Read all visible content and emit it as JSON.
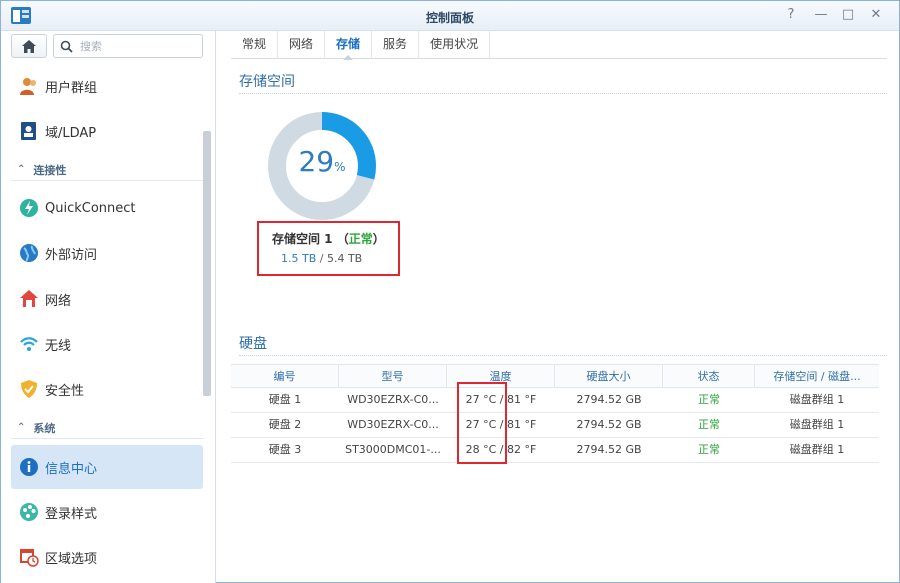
{
  "window": {
    "title": "控制面板"
  },
  "search": {
    "placeholder": "搜索"
  },
  "sidebar": {
    "items": [
      {
        "label": "用户群组"
      },
      {
        "label": "域/LDAP"
      },
      {
        "label": "QuickConnect"
      },
      {
        "label": "外部访问"
      },
      {
        "label": "网络"
      },
      {
        "label": "无线"
      },
      {
        "label": "安全性"
      },
      {
        "label": "信息中心"
      },
      {
        "label": "登录样式"
      },
      {
        "label": "区域选项"
      }
    ],
    "sections": [
      {
        "label": "连接性"
      },
      {
        "label": "系统"
      }
    ]
  },
  "tabs": [
    {
      "label": "常规"
    },
    {
      "label": "网络"
    },
    {
      "label": "存储"
    },
    {
      "label": "服务"
    },
    {
      "label": "使用状况"
    }
  ],
  "storage": {
    "heading": "存储空间",
    "usage_percent": 29,
    "usage_number": "29",
    "usage_unit": "%",
    "volume_name": "存储空间 1",
    "volume_status_open": "（",
    "volume_status": "正常",
    "volume_status_close": "）",
    "used": "1.5 TB",
    "separator": " / ",
    "total": "5.4 TB"
  },
  "disks": {
    "heading": "硬盘",
    "columns": [
      "编号",
      "型号",
      "温度",
      "硬盘大小",
      "状态",
      "存储空间 / 磁盘..."
    ],
    "rows": [
      {
        "id": "硬盘 1",
        "model": "WD30EZRX-C0...",
        "temp": "27 °C / 81 °F",
        "size": "2794.52 GB",
        "status": "正常",
        "group": "磁盘群组 1"
      },
      {
        "id": "硬盘 2",
        "model": "WD30EZRX-C0...",
        "temp": "27 °C / 81 °F",
        "size": "2794.52 GB",
        "status": "正常",
        "group": "磁盘群组 1"
      },
      {
        "id": "硬盘 3",
        "model": "ST3000DMC01-...",
        "temp": "28 °C / 82 °F",
        "size": "2794.52 GB",
        "status": "正常",
        "group": "磁盘群组 1"
      }
    ]
  },
  "colors": {
    "accent": "#1a9be6",
    "donut_bg": "#d0dae3",
    "ok": "#2ea43a",
    "highlight": "#e0262f"
  }
}
